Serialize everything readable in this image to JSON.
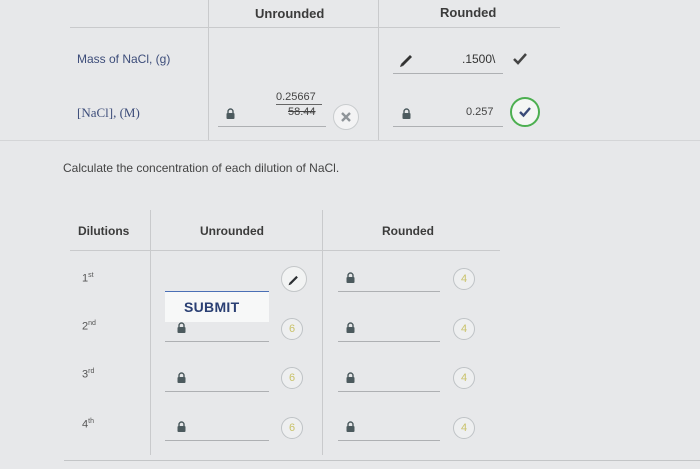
{
  "top_table": {
    "headers": {
      "unrounded": "Unrounded",
      "rounded": "Rounded"
    },
    "rows": [
      {
        "label": "Mass of NaCl, (g)",
        "rounded_value": ".1500\\"
      },
      {
        "label": "[NaCl], (M)",
        "unrounded_numerator": "0.25667",
        "unrounded_denominator": "58.44",
        "rounded_value": "0.257"
      }
    ]
  },
  "instruction": "Calculate the concentration of each dilution of NaCl.",
  "dilutions_table": {
    "headers": {
      "dilutions": "Dilutions",
      "unrounded": "Unrounded",
      "rounded": "Rounded"
    },
    "rows": [
      {
        "num": "1",
        "suffix": "st",
        "unrounded_badge": "",
        "rounded_badge": "4"
      },
      {
        "num": "2",
        "suffix": "nd",
        "unrounded_badge": "6",
        "rounded_badge": "4"
      },
      {
        "num": "3",
        "suffix": "rd",
        "unrounded_badge": "6",
        "rounded_badge": "4"
      },
      {
        "num": "4",
        "suffix": "th",
        "unrounded_badge": "6",
        "rounded_badge": "4"
      }
    ],
    "submit_label": "SUBMIT"
  },
  "colors": {
    "accent_green": "#4caf50",
    "error_gray": "#9ea3a7",
    "lock": "#4c5a5e"
  }
}
